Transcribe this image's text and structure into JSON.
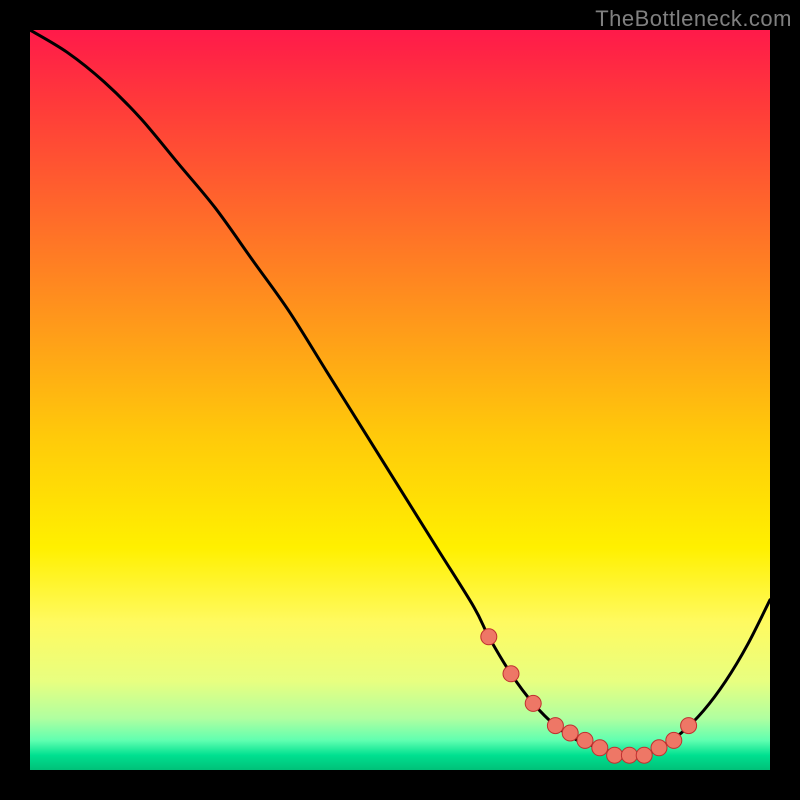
{
  "watermark": "TheBottleneck.com",
  "chart_data": {
    "type": "line",
    "title": "",
    "xlabel": "",
    "ylabel": "",
    "xlim": [
      0,
      100
    ],
    "ylim": [
      0,
      100
    ],
    "series": [
      {
        "name": "bottleneck-curve",
        "x": [
          0,
          5,
          10,
          15,
          20,
          25,
          30,
          35,
          40,
          45,
          50,
          55,
          60,
          62,
          65,
          68,
          71,
          74,
          77,
          80,
          83,
          85,
          88,
          91,
          94,
          97,
          100
        ],
        "values": [
          100,
          97,
          93,
          88,
          82,
          76,
          69,
          62,
          54,
          46,
          38,
          30,
          22,
          18,
          13,
          9,
          6,
          4,
          3,
          2,
          2,
          3,
          5,
          8,
          12,
          17,
          23
        ]
      }
    ],
    "markers": {
      "name": "marker-points",
      "x": [
        62,
        65,
        68,
        71,
        73,
        75,
        77,
        79,
        81,
        83,
        85,
        87,
        89
      ],
      "values": [
        18,
        13,
        9,
        6,
        5,
        4,
        3,
        2,
        2,
        2,
        3,
        4,
        6
      ]
    },
    "colors": {
      "curve": "#000000",
      "marker_fill": "#ee7766",
      "marker_stroke": "#c03030",
      "background_top": "#ff1a4a",
      "background_bottom": "#00c078",
      "frame": "#000000"
    }
  }
}
